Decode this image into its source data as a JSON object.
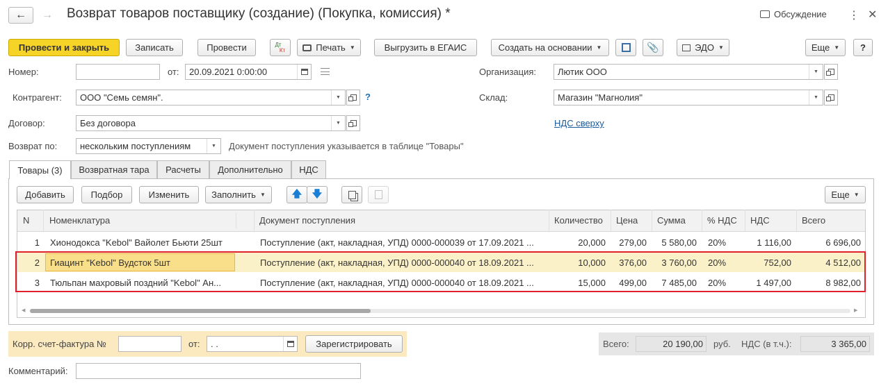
{
  "window": {
    "title": "Возврат товаров поставщику (создание) (Покупка, комиссия) *",
    "discussion_label": "Обсуждение"
  },
  "toolbar": {
    "post_close": "Провести и закрыть",
    "save": "Записать",
    "post": "Провести",
    "dtkt_top": "Дт",
    "dtkt_bottom": "Кт",
    "print": "Печать",
    "egais": "Выгрузить в ЕГАИС",
    "create_based": "Создать на основании",
    "edo": "ЭДО",
    "more": "Еще",
    "help": "?"
  },
  "header": {
    "number_label": "Номер:",
    "number_value": "",
    "from_label": "от:",
    "date_value": "20.09.2021  0:00:00",
    "org_label": "Организация:",
    "org_value": "Лютик ООО",
    "counterparty_label": "Контрагент:",
    "counterparty_value": "ООО \"Семь семян\".",
    "question": "?",
    "warehouse_label": "Склад:",
    "warehouse_value": "Магазин \"Магнолия\"",
    "contract_label": "Договор:",
    "contract_value": "Без договора",
    "vat_link": "НДС сверху",
    "return_by_label": "Возврат по:",
    "return_by_value": "нескольким поступлениям",
    "return_hint": "Документ поступления указывается в таблице \"Товары\""
  },
  "tabs": [
    "Товары (3)",
    "Возвратная тара",
    "Расчеты",
    "Дополнительно",
    "НДС"
  ],
  "table_toolbar": {
    "add": "Добавить",
    "select": "Подбор",
    "edit": "Изменить",
    "fill": "Заполнить",
    "more": "Еще"
  },
  "table": {
    "columns": [
      "N",
      "Номенклатура",
      "Документ поступления",
      "Количество",
      "Цена",
      "Сумма",
      "% НДС",
      "НДС",
      "Всего"
    ],
    "rows": [
      {
        "n": "1",
        "item": "Хионодокса \"Kebol\" Вайолет Бьюти 25шт",
        "doc": "Поступление (акт, накладная, УПД) 0000-000039 от 17.09.2021 ...",
        "qty": "20,000",
        "price": "279,00",
        "sum": "5 580,00",
        "vat_rate": "20%",
        "vat": "1 116,00",
        "total": "6 696,00"
      },
      {
        "n": "2",
        "item": "Гиацинт \"Kebol\" Вудсток 5шт",
        "doc": "Поступление (акт, накладная, УПД) 0000-000040 от 18.09.2021 ...",
        "qty": "10,000",
        "price": "376,00",
        "sum": "3 760,00",
        "vat_rate": "20%",
        "vat": "752,00",
        "total": "4 512,00"
      },
      {
        "n": "3",
        "item": "Тюльпан махровый поздний \"Kebol\" Ан...",
        "doc": "Поступление (акт, накладная, УПД) 0000-000040 от 18.09.2021 ...",
        "qty": "15,000",
        "price": "499,00",
        "sum": "7 485,00",
        "vat_rate": "20%",
        "vat": "1 497,00",
        "total": "8 982,00"
      }
    ]
  },
  "footer": {
    "corr_invoice_label": "Корр. счет-фактура №",
    "corr_number": "",
    "from_label": "от:",
    "corr_date": " .  .",
    "register": "Зарегистрировать",
    "total_label": "Всего:",
    "total_value": "20 190,00",
    "currency": "руб.",
    "vat_label": "НДС (в т.ч.):",
    "vat_value": "3 365,00",
    "comment_label": "Комментарий:",
    "comment_value": ""
  },
  "colors": {
    "primary_button": "#f5d327",
    "selected_row": "#fbf1c8",
    "highlight_border": "#e0202a",
    "footer_left_bg": "#fbe9c0",
    "footer_right_bg": "#e6e6e6"
  }
}
